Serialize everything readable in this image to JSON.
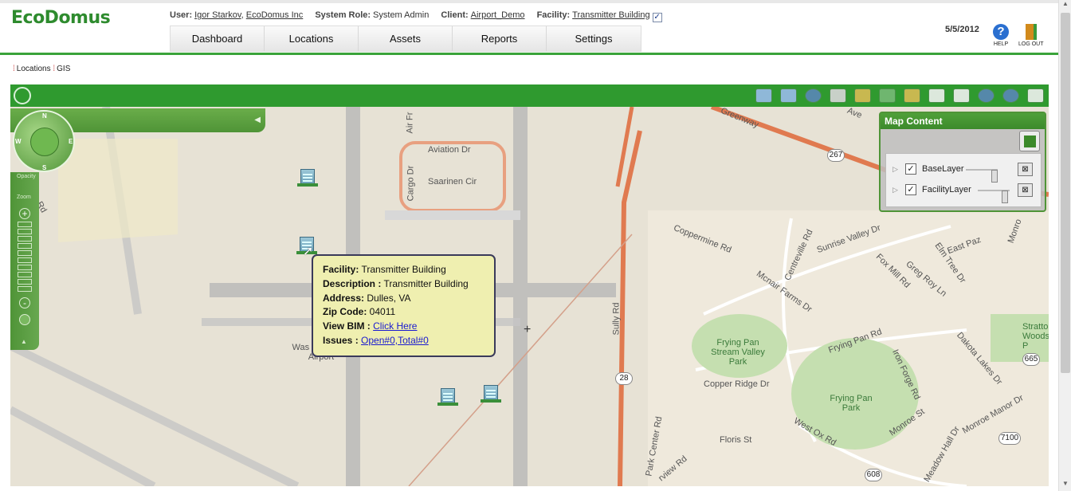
{
  "header": {
    "logo": "EcoDomus",
    "user_label": "User:",
    "user_name": "Igor Starkov",
    "user_company": "EcoDomus Inc",
    "role_label": "System Role:",
    "role_value": "System Admin",
    "client_label": "Client:",
    "client_value": "Airport_Demo",
    "facility_label": "Facility:",
    "facility_value": "Transmitter Building",
    "facility_checked": "✓",
    "date": "5/5/2012",
    "help_label": "HELP",
    "logout_label": "LOG OUT"
  },
  "nav": {
    "tabs": [
      "Dashboard",
      "Locations",
      "Assets",
      "Reports",
      "Settings"
    ]
  },
  "breadcrumb": {
    "items": [
      "Locations",
      "GIS"
    ]
  },
  "map_controls": {
    "compass": {
      "n": "N",
      "s": "S",
      "e": "E",
      "w": "W"
    },
    "zoom_in": "+",
    "zoom_out": "-",
    "zoom_steps": 10,
    "zoom_label": "Zoom",
    "opacity_label": "Opacity"
  },
  "map_content": {
    "title": "Map Content",
    "layers": [
      {
        "name": "BaseLayer",
        "checked": "✓",
        "opacity": 0.9
      },
      {
        "name": "FacilityLayer",
        "checked": "✓",
        "opacity": 0.85
      }
    ],
    "remove_glyph": "⊠"
  },
  "popup": {
    "facility_label": "Facility:",
    "facility_value": "Transmitter Building",
    "description_label": "Description :",
    "description_value": "Transmitter Building",
    "address_label": "Address:",
    "address_value": "Dulles, VA",
    "zip_label": "Zip Code:",
    "zip_value": "04011",
    "bim_label": "View BIM :",
    "bim_link": "Click Here",
    "issues_label": "Issues :",
    "issues_link": "Open#0,Total#0"
  },
  "map_labels": {
    "aviation_dr": "Aviation Dr",
    "saarinen_cir": "Saarinen Cir",
    "cargo_dr": "Cargo Dr",
    "air_fr": "Air Fr",
    "greenway": "Greenway",
    "coppermine_rd": "Coppermine Rd",
    "centreville_rd": "Centreville Rd",
    "sunrise_valley": "Sunrise Valley Dr",
    "east_paz": "East Paz",
    "elm_tree_dr": "Elm Tree Dr",
    "fox_mill_rd": "Fox Mill Rd",
    "greg_roy_ln": "Greg Roy Ln",
    "mcnair_farms_dr": "Mcnair Farms Dr",
    "frying_pan_rd": "Frying Pan Rd",
    "sully_rd": "Sully Rd",
    "frying_pan_svp": "Frying Pan Stream Valley Park",
    "copper_ridge_dr": "Copper Ridge Dr",
    "frying_pan_park": "Frying Pan Park",
    "iron_forge_rd": "Iron Forge Rd",
    "dakota_lakes_dr": "Dakota Lakes Dr",
    "stratton_woods": "Stratto Woods P",
    "west_ox_rd": "West Ox Rd",
    "monroe_manor_dr": "Monroe Manor Dr",
    "monroe_st": "Monroe St",
    "meadow_hall_dr": "Meadow Hall Dr",
    "floris_st": "Floris St",
    "park_center_rd": "Park Center Rd",
    "airview_rd": "rview Rd",
    "washington_dulles": "Was Dulles Intl Airport",
    "rd_left": "Rd",
    "ave": "Ave",
    "monro": "Monro",
    "shield_267": "267",
    "shield_28": "28",
    "shield_665": "665",
    "shield_7100": "7100",
    "shield_608": "608"
  }
}
